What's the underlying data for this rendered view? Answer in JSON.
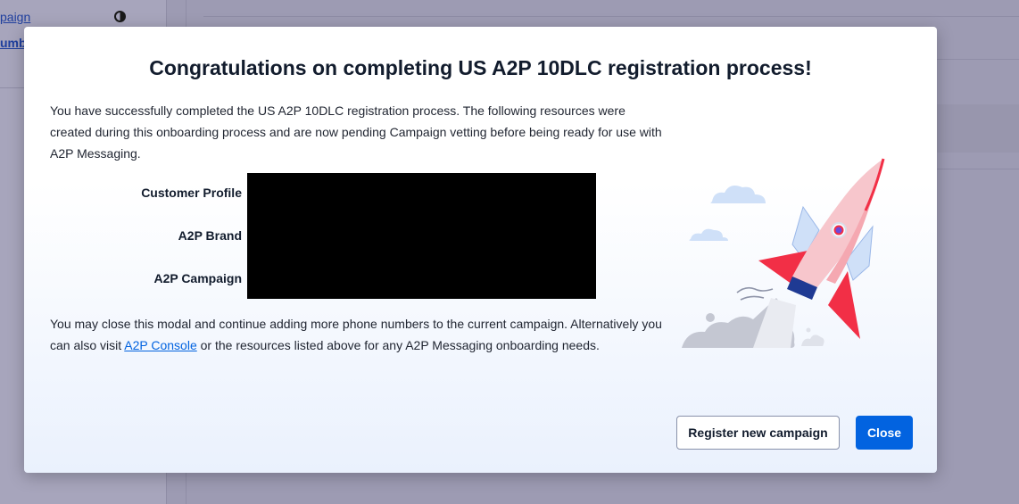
{
  "background": {
    "sidebar_links": [
      "paign",
      "umb"
    ]
  },
  "modal": {
    "title": "Congratulations on completing US A2P 10DLC registration process!",
    "intro": "You have successfully completed the US A2P 10DLC registration process. The following resources were created during this onboarding process and are now pending Campaign vetting before being ready for use with A2P Messaging.",
    "resources": [
      {
        "label": "Customer Profile"
      },
      {
        "label": "A2P Brand"
      },
      {
        "label": "A2P Campaign"
      }
    ],
    "outro_before": "You may close this modal and continue adding more phone numbers to the current campaign. Alternatively you can also visit ",
    "outro_link": "A2P Console",
    "outro_after": " or the resources listed above for any A2P Messaging onboarding needs.",
    "buttons": {
      "register": "Register new campaign",
      "close": "Close"
    },
    "illustration_icon": "rocket-launch-icon"
  },
  "colors": {
    "primary": "#0263e0",
    "title": "#121c2d",
    "overlay": "#9d9bb3",
    "rocket_red": "#f22f46"
  }
}
